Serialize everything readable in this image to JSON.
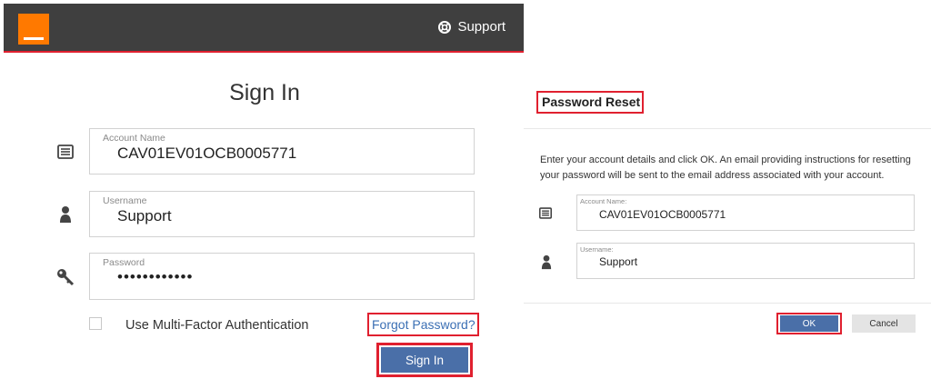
{
  "brand": {
    "logo_color": "#ff7900",
    "bar_color": "#3f3f3f",
    "accent_red": "#e0202f"
  },
  "header": {
    "support_label": "Support",
    "support_icon": "lifebuoy-icon"
  },
  "signin": {
    "title": "Sign In",
    "account": {
      "label": "Account Name",
      "value": "CAV01EV01OCB0005771",
      "icon": "id-card-icon"
    },
    "username": {
      "label": "Username",
      "value": "Support",
      "icon": "user-icon"
    },
    "password": {
      "label": "Password",
      "value": "••••••••••••",
      "icon": "key-icon"
    },
    "mfa_label": "Use Multi-Factor Authentication",
    "mfa_checked": false,
    "forgot_label": "Forgot Password?",
    "submit_label": "Sign In",
    "button_color": "#4a6fa8",
    "link_color": "#3b6fb4"
  },
  "reset_dialog": {
    "title": "Password Reset",
    "description": "Enter your account details and click OK. An email providing instructions for resetting your password will be sent to the email address associated with your account.",
    "account": {
      "label": "Account Name:",
      "value": "CAV01EV01OCB0005771",
      "icon": "id-card-icon"
    },
    "username": {
      "label": "Username:",
      "value": "Support",
      "icon": "user-icon"
    },
    "ok_label": "OK",
    "cancel_label": "Cancel"
  }
}
